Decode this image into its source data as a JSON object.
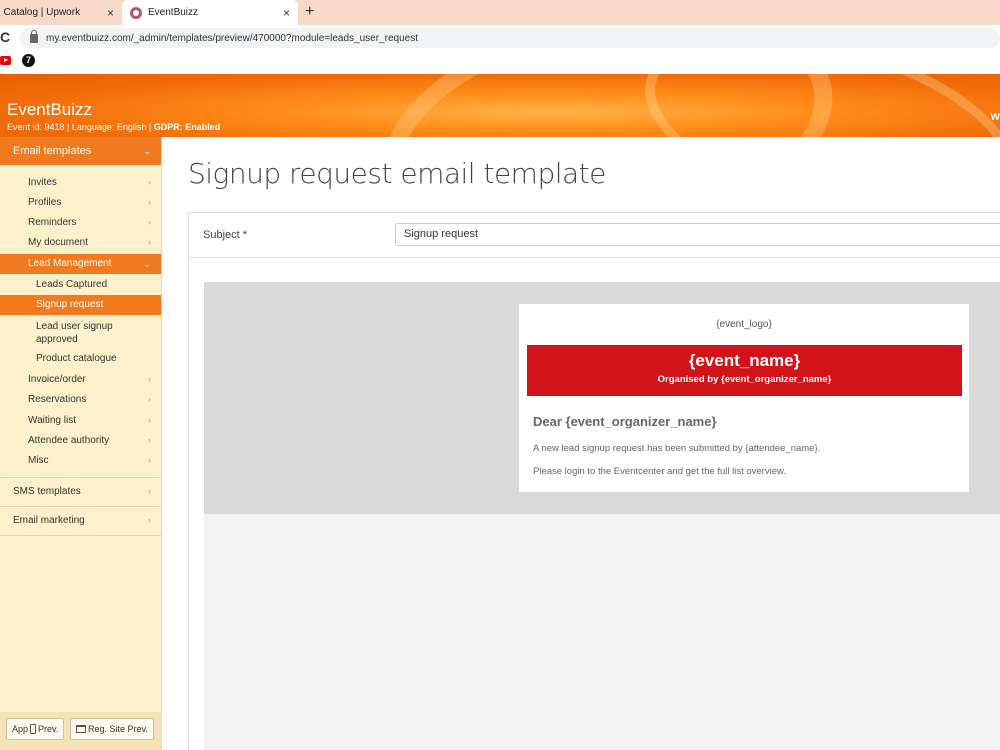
{
  "browser": {
    "tabs": [
      {
        "label": ": Catalog | Upwork",
        "close": "×"
      },
      {
        "label": "EventBuizz",
        "close": "×"
      }
    ],
    "new_tab": "+",
    "reload": "C",
    "url": "my.eventbuizz.com/_admin/templates/preview/470000?module=leads_user_request",
    "bookmark2": "7"
  },
  "header": {
    "brand": "EventBuizz",
    "event_info": "Event id: 9418 | Language: English |",
    "gdpr": "GDPR: Enabled",
    "right_text": "W"
  },
  "sidebar": {
    "section": "Email templates",
    "items": [
      {
        "label": "Invites"
      },
      {
        "label": "Profiles"
      },
      {
        "label": "Reminders"
      },
      {
        "label": "My document"
      },
      {
        "label": "Lead Management"
      },
      {
        "label": "Invoice/order"
      },
      {
        "label": "Reservations"
      },
      {
        "label": "Waiting list"
      },
      {
        "label": "Attendee authority"
      },
      {
        "label": "Misc"
      }
    ],
    "sub_items": [
      {
        "label": "Leads Captured"
      },
      {
        "label": "Signup request"
      },
      {
        "label": "Lead user signup approved"
      },
      {
        "label": "Product catalogue"
      }
    ],
    "groups": [
      {
        "label": "SMS templates"
      },
      {
        "label": "Email marketing"
      }
    ],
    "footer": {
      "app_prev_a": "App",
      "app_prev_b": "Prev.",
      "reg_site_prev": "Reg. Site Prev."
    },
    "chevron": "›",
    "chevron_down": "⌄"
  },
  "main": {
    "title": "Signup request email template",
    "subject_label": "Subject *",
    "subject_value": "Signup request",
    "email": {
      "logo": "{event_logo}",
      "event_name": "{event_name}",
      "organised_by": "Organised by {event_organizer_name}",
      "dear": "Dear {event_organizer_name}",
      "line1": "A new lead signup request has been submitted by {attendee_name}.",
      "line2": "Please login to the Eventcenter and get the full list overview."
    }
  },
  "colors": {
    "accent": "#f07a20",
    "sidebar_bg": "#fff1cc",
    "banner_red": "#d0141a"
  }
}
